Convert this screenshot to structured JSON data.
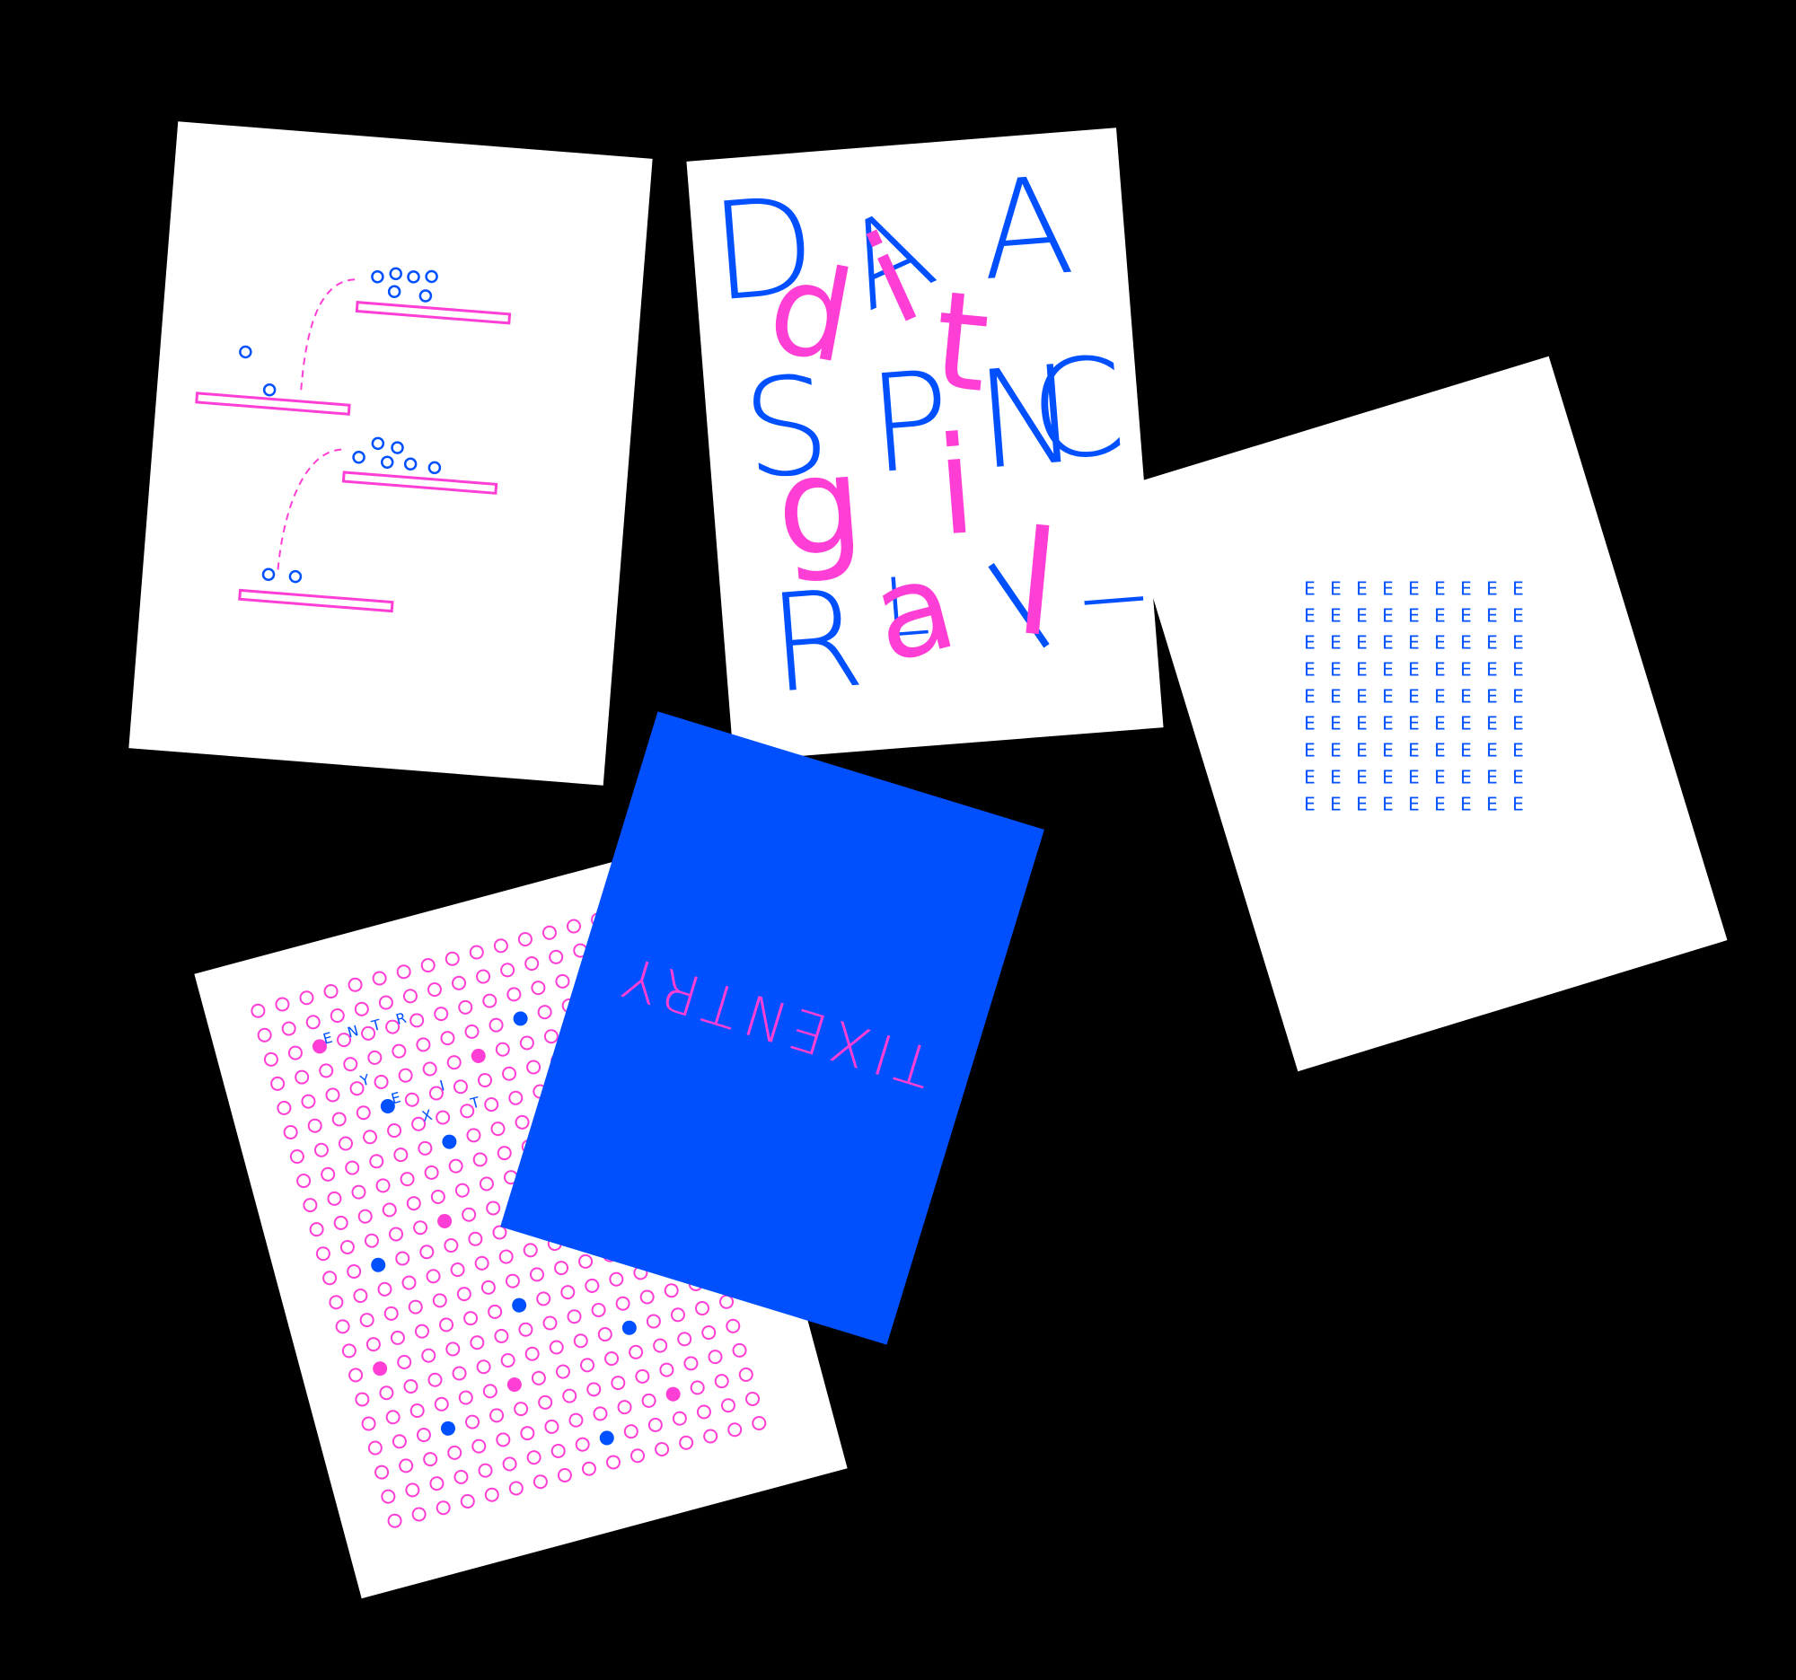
{
  "colors": {
    "background": "#000000",
    "card": "#ffffff",
    "blue": "#0050ff",
    "pink": "#ff3ed6"
  },
  "cards": {
    "dots_poster": {
      "description": ""
    },
    "letters_poster": {
      "blue_letters": [
        "D",
        "A",
        "S",
        "P",
        "C",
        "R",
        "A",
        "N",
        "I",
        "L",
        "I"
      ],
      "pink_letters": [
        "d",
        "i",
        "t",
        "g",
        "i",
        "a",
        "l"
      ]
    },
    "e_grid_poster": {
      "letter": "E"
    },
    "circles_poster": {
      "words": [
        "E",
        "N",
        "T",
        "R",
        "Y",
        "E",
        "X",
        "I",
        "T",
        "E",
        "N",
        "T",
        "R",
        "Y"
      ]
    },
    "mirror_poster": {
      "text": "TIXENTRY"
    }
  }
}
